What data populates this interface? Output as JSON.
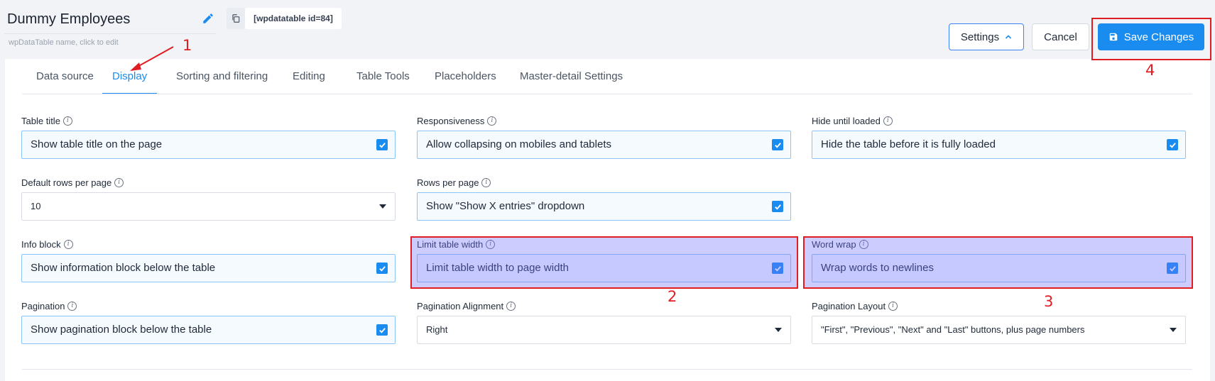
{
  "header": {
    "title": "Dummy Employees",
    "title_hint": "wpDataTable name, click to edit",
    "shortcode": "[wpdatatable id=84]",
    "buttons": {
      "settings": "Settings",
      "cancel": "Cancel",
      "save": "Save Changes"
    }
  },
  "tabs": [
    {
      "label": "Data source"
    },
    {
      "label": "Display",
      "active": true
    },
    {
      "label": "Sorting and filtering"
    },
    {
      "label": "Editing"
    },
    {
      "label": "Table Tools"
    },
    {
      "label": "Placeholders"
    },
    {
      "label": "Master-detail Settings"
    }
  ],
  "fields": {
    "table_title": {
      "label": "Table title",
      "text": "Show table title on the page",
      "checked": true
    },
    "responsiveness": {
      "label": "Responsiveness",
      "text": "Allow collapsing on mobiles and tablets",
      "checked": true
    },
    "hide_until_loaded": {
      "label": "Hide until loaded",
      "text": "Hide the table before it is fully loaded",
      "checked": true
    },
    "default_rows": {
      "label": "Default rows per page",
      "value": "10"
    },
    "rows_per_page": {
      "label": "Rows per page",
      "text": "Show \"Show X entries\" dropdown",
      "checked": true
    },
    "info_block": {
      "label": "Info block",
      "text": "Show information block below the table",
      "checked": true
    },
    "limit_width": {
      "label": "Limit table width",
      "text": "Limit table width to page width",
      "checked": true
    },
    "word_wrap": {
      "label": "Word wrap",
      "text": "Wrap words to newlines",
      "checked": true
    },
    "pagination": {
      "label": "Pagination",
      "text": "Show pagination block below the table",
      "checked": true
    },
    "pagination_alignment": {
      "label": "Pagination Alignment",
      "value": "Right"
    },
    "pagination_layout": {
      "label": "Pagination Layout",
      "value": "\"First\", \"Previous\", \"Next\" and \"Last\" buttons, plus page numbers"
    }
  },
  "annotations": {
    "n1": "1",
    "n2": "2",
    "n3": "3",
    "n4": "4"
  },
  "colors": {
    "accent": "#1a8cf0",
    "annotation": "#e11d24",
    "highlight": "rgba(110,110,255,0.35)"
  }
}
